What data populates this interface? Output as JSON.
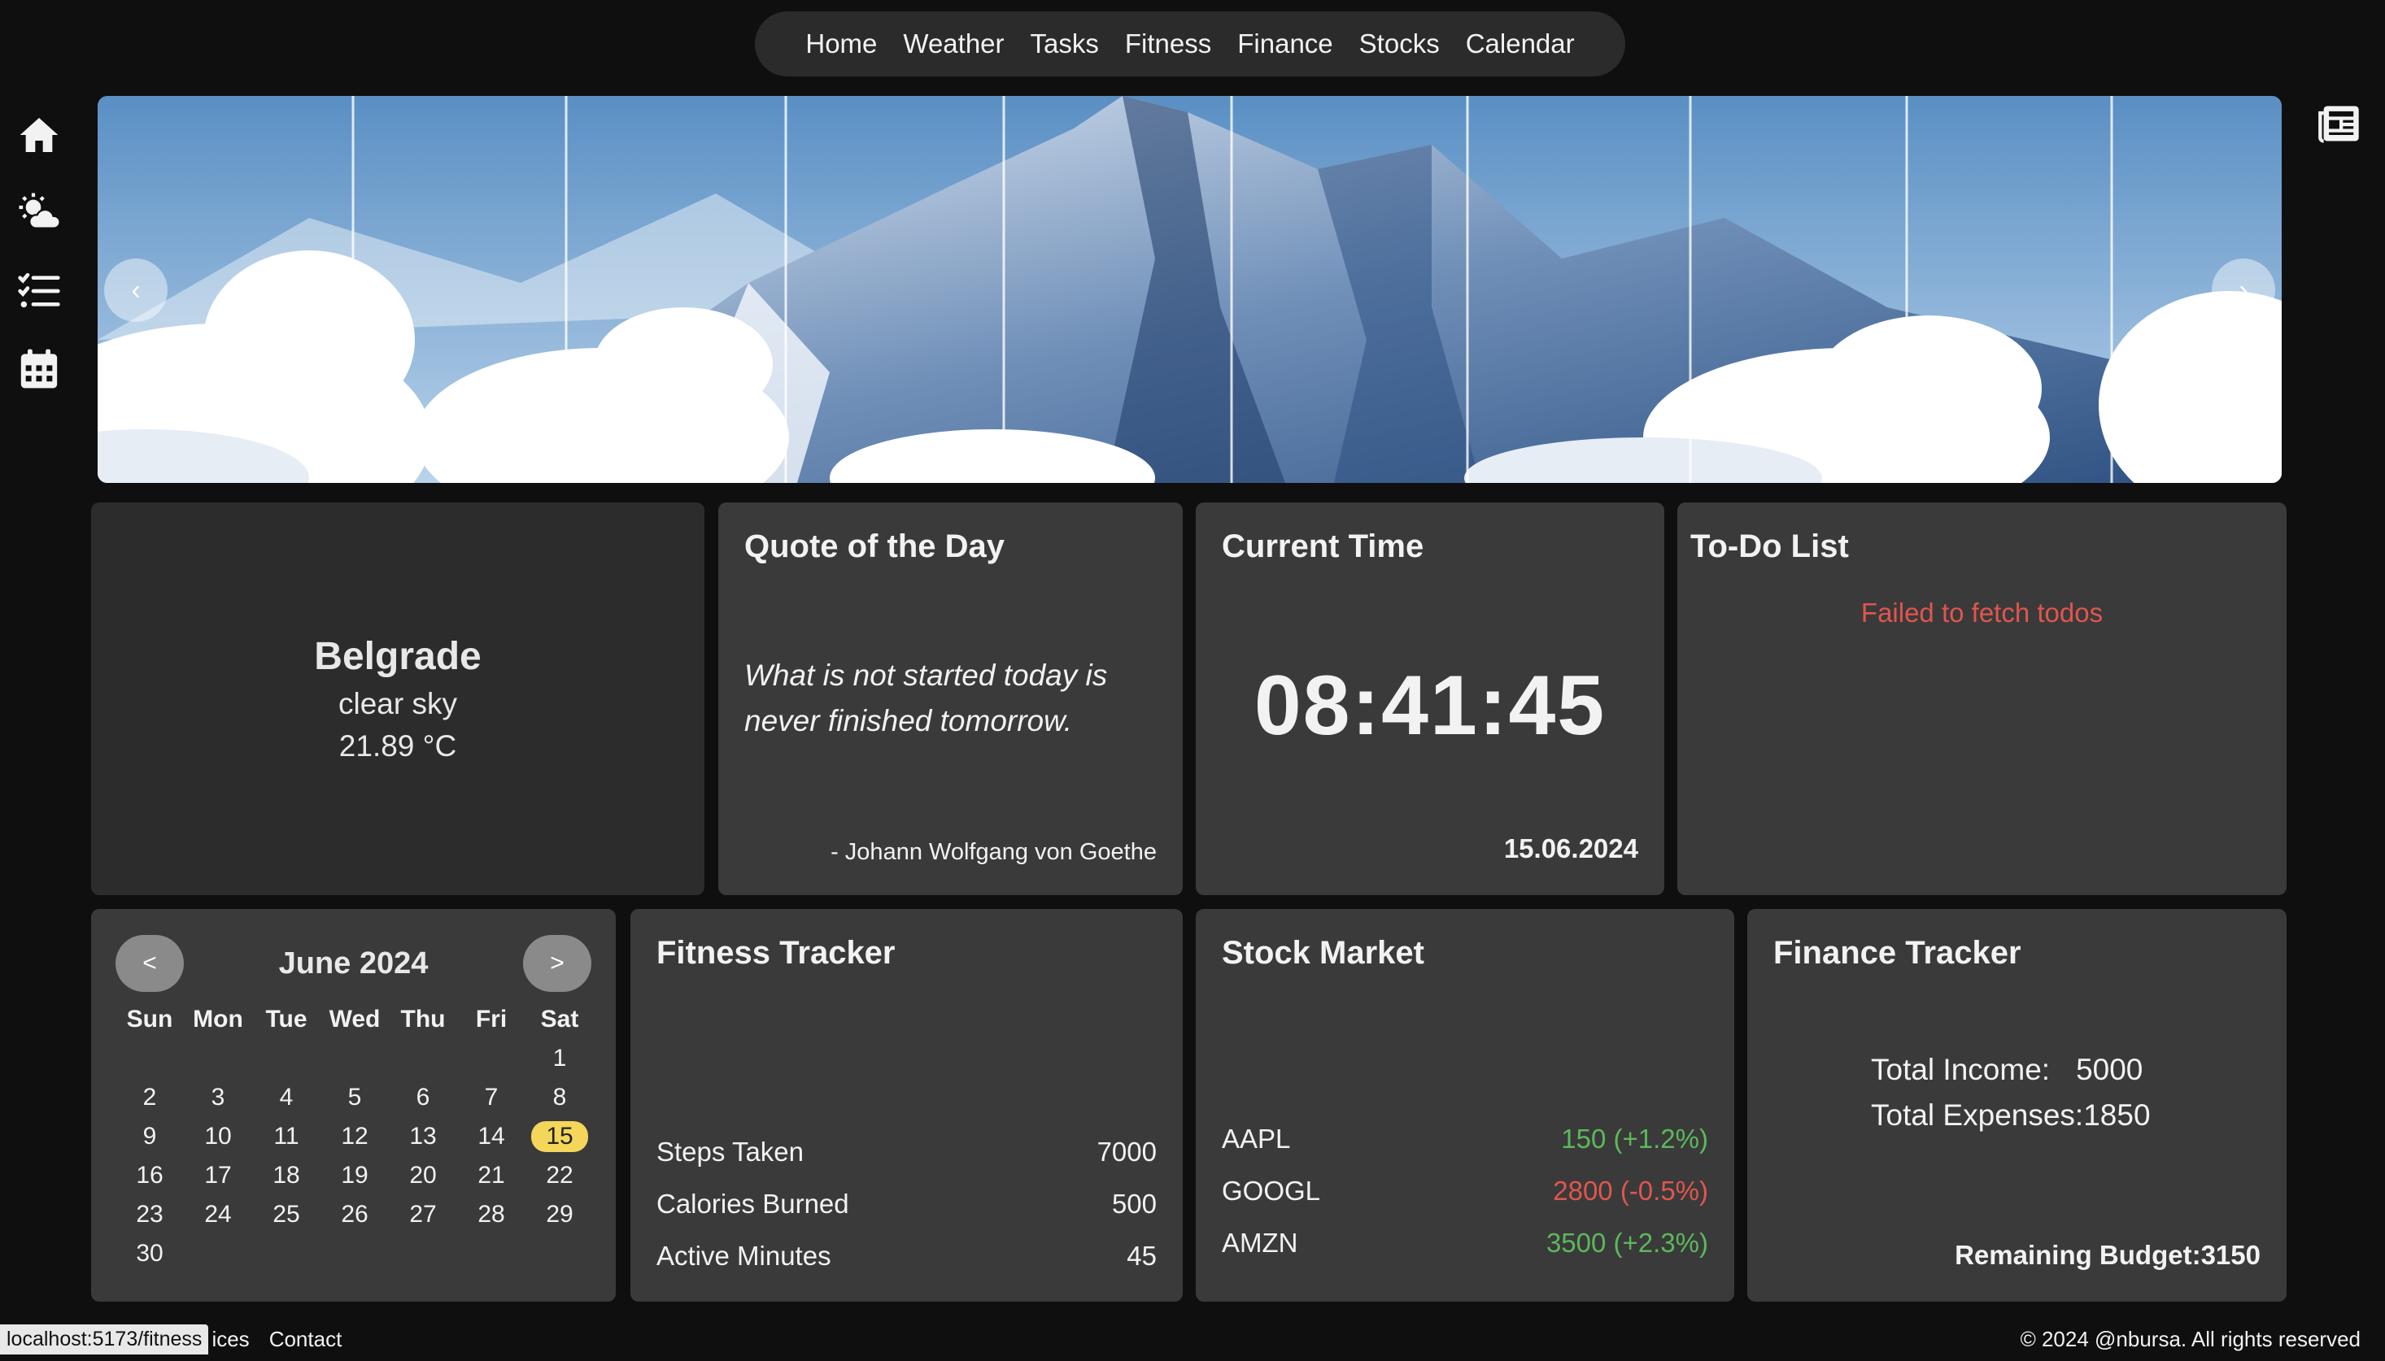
{
  "nav": {
    "items": [
      "Home",
      "Weather",
      "Tasks",
      "Fitness",
      "Finance",
      "Stocks",
      "Calendar"
    ]
  },
  "sidebar": {
    "icons": [
      "home-icon",
      "weather-icon",
      "tasks-icon",
      "calendar-icon"
    ]
  },
  "carousel": {
    "prev_label": "‹",
    "next_label": "›"
  },
  "weather": {
    "city": "Belgrade",
    "description": "clear sky",
    "temperature": "21.89 °C"
  },
  "quote": {
    "title": "Quote of the Day",
    "text": "What is not started today is never finished tomorrow.",
    "author": "- Johann Wolfgang von Goethe"
  },
  "time": {
    "title": "Current Time",
    "clock": "08:41:45",
    "date": "15.06.2024"
  },
  "todo": {
    "title": "To-Do List",
    "error": "Failed to fetch todos"
  },
  "calendar": {
    "title": "June 2024",
    "prev_label": "<",
    "next_label": ">",
    "weekdays": [
      "Sun",
      "Mon",
      "Tue",
      "Wed",
      "Thu",
      "Fri",
      "Sat"
    ],
    "leading_blanks": 6,
    "days_in_month": 30,
    "today": 15
  },
  "fitness": {
    "title": "Fitness Tracker",
    "rows": [
      {
        "label": "Steps Taken",
        "value": "7000"
      },
      {
        "label": "Calories Burned",
        "value": "500"
      },
      {
        "label": "Active Minutes",
        "value": "45"
      }
    ]
  },
  "stocks": {
    "title": "Stock Market",
    "rows": [
      {
        "symbol": "AAPL",
        "price": "150 (+1.2%)",
        "trend": "up"
      },
      {
        "symbol": "GOOGL",
        "price": "2800 (-0.5%)",
        "trend": "down"
      },
      {
        "symbol": "AMZN",
        "price": "3500 (+2.3%)",
        "trend": "up"
      }
    ]
  },
  "finance": {
    "title": "Finance Tracker",
    "income_label": "Total Income:",
    "income_value": "5000",
    "expenses_label": "Total Expenses:",
    "expenses_value": "1850",
    "remaining_label": "Remaining Budget:",
    "remaining_value": "3150"
  },
  "footer": {
    "status_url": "localhost:5173/fitness",
    "links": [
      "ices",
      "Contact"
    ],
    "copyright": "© 2024 @nbursa. All rights reserved"
  },
  "colors": {
    "accent_today": "#f4d65a",
    "positive": "#5cb85c",
    "negative": "#e0564f",
    "card_bg": "#3a3a3a",
    "page_bg": "#0f0f0f"
  }
}
